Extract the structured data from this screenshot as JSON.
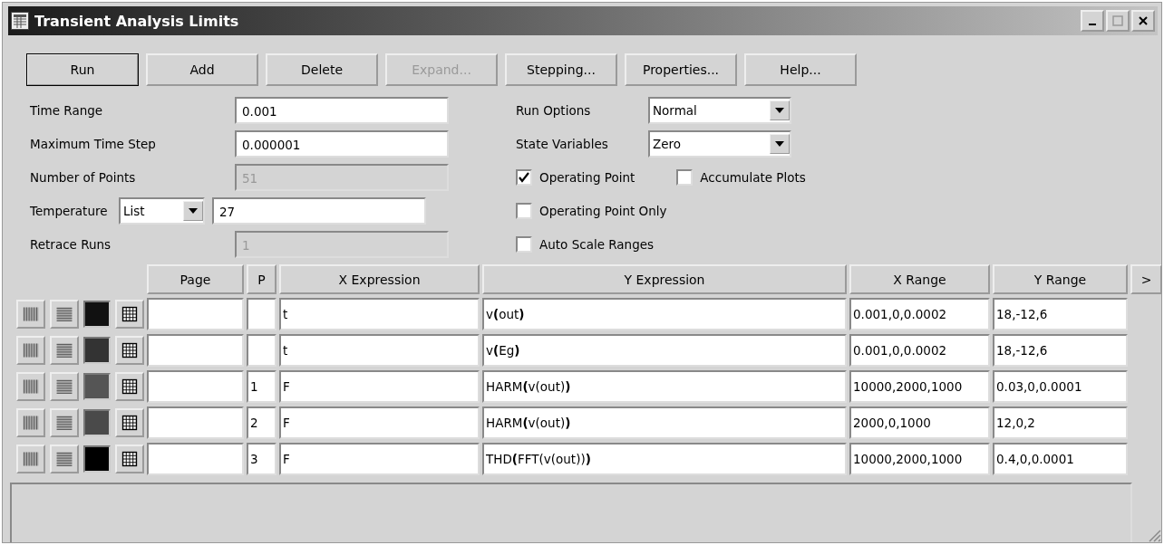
{
  "window": {
    "title": "Transient Analysis Limits"
  },
  "buttons": [
    {
      "label": "Run",
      "disabled": false,
      "default": true
    },
    {
      "label": "Add",
      "disabled": false,
      "default": false
    },
    {
      "label": "Delete",
      "disabled": false,
      "default": false
    },
    {
      "label": "Expand...",
      "disabled": true,
      "default": false
    },
    {
      "label": "Stepping...",
      "disabled": false,
      "default": false
    },
    {
      "label": "Properties...",
      "disabled": false,
      "default": false
    },
    {
      "label": "Help...",
      "disabled": false,
      "default": false
    }
  ],
  "fields": [
    {
      "kind": "text",
      "label": "Time Range",
      "value": "0.001",
      "disabled": false
    },
    {
      "kind": "text",
      "label": "Maximum Time Step",
      "value": "0.000001",
      "disabled": false
    },
    {
      "kind": "text",
      "label": "Number of Points",
      "value": "51",
      "disabled": true
    },
    {
      "kind": "select-text",
      "label": "Temperature",
      "select": "List",
      "value": "27",
      "disabled": false
    },
    {
      "kind": "text",
      "label": "Retrace Runs",
      "value": "1",
      "disabled": true
    }
  ],
  "options": [
    {
      "label": "Run Options",
      "value": "Normal"
    },
    {
      "label": "State Variables",
      "value": "Zero"
    }
  ],
  "checkbox_rows": [
    [
      {
        "label": "Operating Point",
        "checked": true
      },
      {
        "label": "Accumulate Plots",
        "checked": false
      }
    ],
    [
      {
        "label": "Operating Point Only",
        "checked": false
      }
    ],
    [
      {
        "label": "Auto Scale Ranges",
        "checked": false
      }
    ]
  ],
  "table": {
    "columns": [
      "Page",
      "P",
      "X Expression",
      "Y Expression",
      "X Range",
      "Y Range"
    ],
    "more": ">",
    "rows": [
      {
        "color": "#111111",
        "page": "",
        "p": "",
        "x_expression": "t",
        "y_expression": "v**(**out**)**",
        "x_range": "0.001,0,0.0002",
        "y_range": "18,-12,6"
      },
      {
        "color": "#333333",
        "page": "",
        "p": "",
        "x_expression": "t",
        "y_expression": "v**(**Eg**)**",
        "x_range": "0.001,0,0.0002",
        "y_range": "18,-12,6"
      },
      {
        "color": "#555555",
        "page": "",
        "p": "1",
        "x_expression": "F",
        "y_expression": "HARM**(**v(out)**)**",
        "x_range": "10000,2000,1000",
        "y_range": "0.03,0,0.0001"
      },
      {
        "color": "#4a4a4a",
        "page": "",
        "p": "2",
        "x_expression": "F",
        "y_expression": "HARM**(**v(out)**)**",
        "x_range": "2000,0,1000",
        "y_range": "12,0,2"
      },
      {
        "color": "#000000",
        "page": "",
        "p": "3",
        "x_expression": "F",
        "y_expression": "THD**(**FFT(v(out))**)**",
        "x_range": "10000,2000,1000",
        "y_range": "0.4,0,0.0001"
      }
    ]
  }
}
